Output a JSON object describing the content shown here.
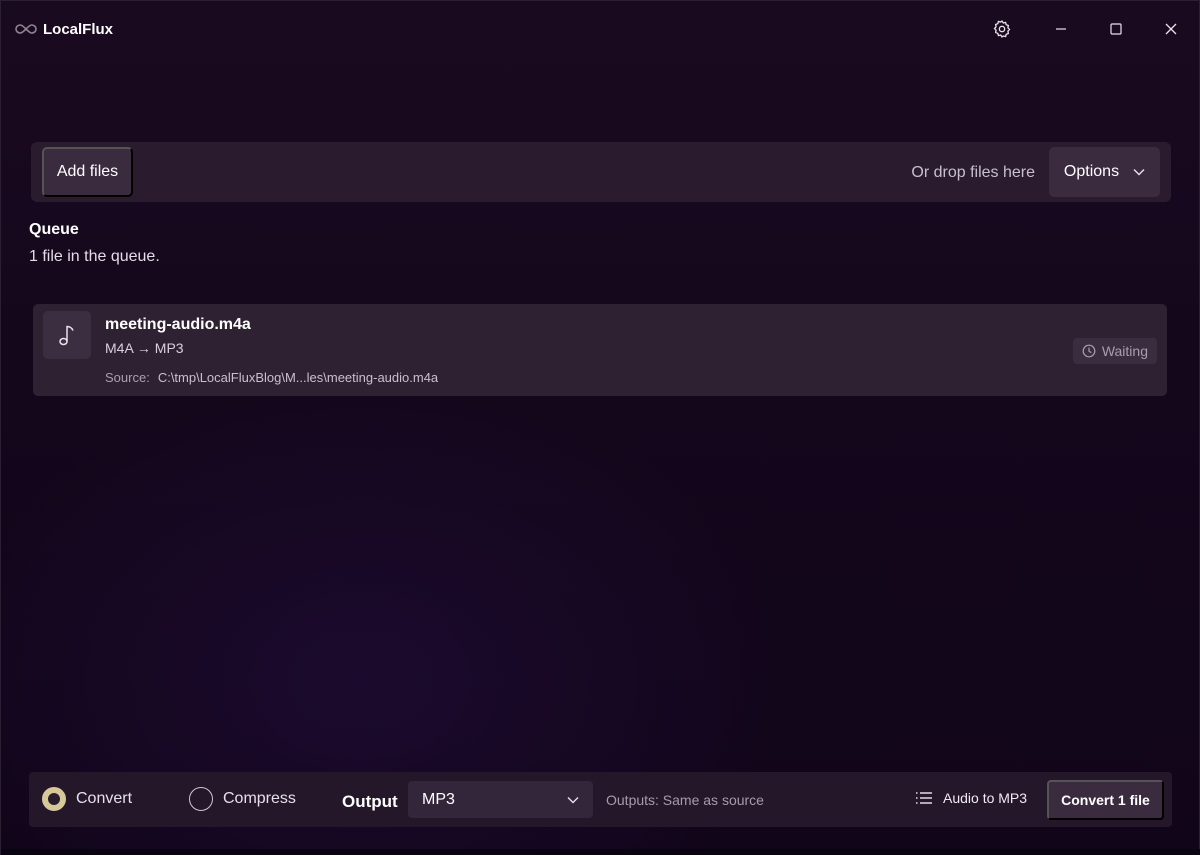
{
  "app": {
    "title": "LocalFlux"
  },
  "addbar": {
    "add_files_label": "Add files",
    "drop_hint": "Or drop files here",
    "options_label": "Options"
  },
  "queue": {
    "title": "Queue",
    "count_text": "1 file in the queue.",
    "items": [
      {
        "name": "meeting-audio.m4a",
        "conversion": "M4A → MP3",
        "source_label": "Source:",
        "source_path": "C:\\tmp\\LocalFluxBlog\\M...les\\meeting-audio.m4a",
        "status": "Waiting",
        "icon": "music-note-icon"
      }
    ]
  },
  "bottombar": {
    "mode_convert_label": "Convert",
    "mode_compress_label": "Compress",
    "selected_mode": "Convert",
    "output_label": "Output",
    "output_value": "MP3",
    "outputs_hint": "Outputs: Same as source",
    "preset_label": "Audio to MP3",
    "convert_button_label": "Convert 1 file"
  },
  "colors": {
    "background": "#14071c",
    "panel": "#2a1c2e",
    "button": "#3a2b3f",
    "radio_selected": "#d6c899"
  }
}
